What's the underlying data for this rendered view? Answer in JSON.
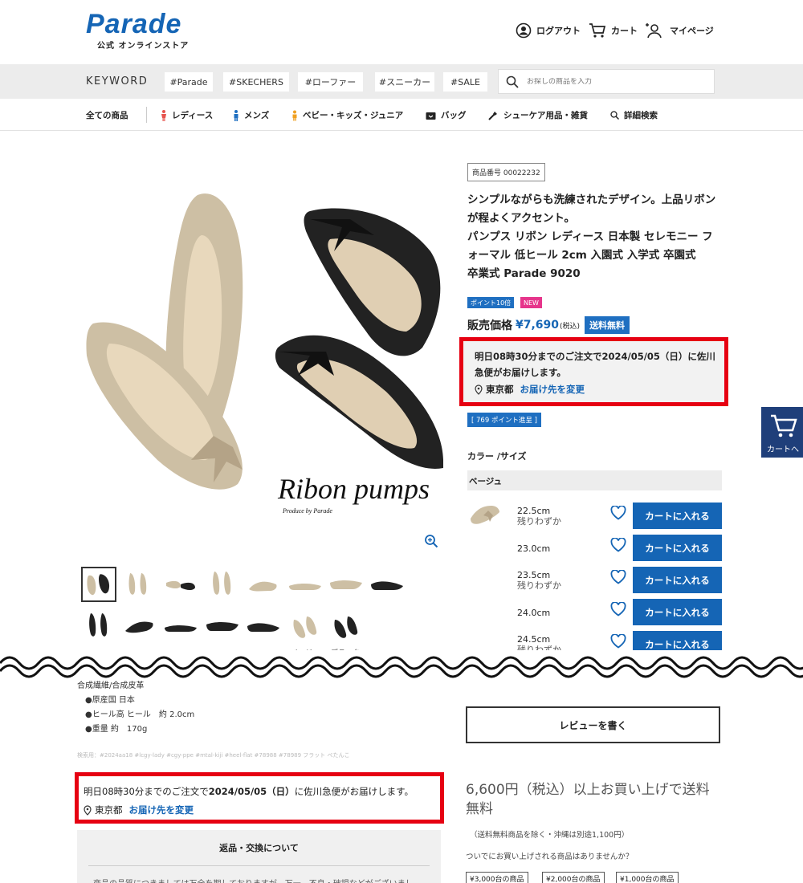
{
  "header": {
    "logo": "Parade",
    "logo_sub": "公式 オンラインストア",
    "logout": "ログアウト",
    "cart": "カート",
    "mypage": "マイページ"
  },
  "keyword": {
    "title": "KEYWORD",
    "tags": [
      "#Parade",
      "#SKECHERS",
      "#ローファー",
      "#スニーカー",
      "#SALE"
    ],
    "placeholder": "お探しの商品を入力"
  },
  "categories": {
    "all": "全ての商品",
    "ladies": "レディース",
    "mens": "メンズ",
    "kids": "ベビー・キッズ・ジュニア",
    "bag": "バッグ",
    "care": "シューケア用品・雑貨",
    "detail": "詳細検索"
  },
  "product": {
    "number": "商品番号 00022232",
    "title_lines": [
      "シンプルながらも洗練されたデザイン。上品リボン",
      "が程よくアクセント。",
      "パンプス リボン レディース 日本製 セレモニー フ",
      "ォーマル 低ヒール 2cm 入園式 入学式 卒園式",
      "卒業式 Parade 9020"
    ],
    "badge_points": "ポイント10倍",
    "badge_new": "NEW",
    "price_label": "販売価格",
    "price": "¥7,690",
    "tax": "(税込)",
    "free_shipping": "送料無料",
    "points_gift": "[ 769 ポイント進呈 ]",
    "image_caption": "Ribon pumps",
    "image_produce": "Produce by Parade",
    "thumb_caption_1": "ベージュ",
    "thumb_caption_2": "ブラック"
  },
  "delivery": {
    "text": "明日08時30分までのご注文で2024/05/05（日）に佐川急便がお届けします。",
    "location": "東京都",
    "change": "お届け先を変更"
  },
  "delivery2": {
    "prefix": "明日08時30分までのご注文で",
    "date": "2024/05/05（日）",
    "suffix": "に佐川急便がお届けします。",
    "location": "東京都",
    "change": "お届け先を変更"
  },
  "colorsize": {
    "label": "カラー /サイズ",
    "color": "ベージュ",
    "cart_button": "カートに入れる",
    "rows": [
      {
        "size": "22.5cm",
        "stock": "残りわずか"
      },
      {
        "size": "23.0cm",
        "stock": ""
      },
      {
        "size": "23.5cm",
        "stock": "残りわずか"
      },
      {
        "size": "24.0cm",
        "stock": ""
      },
      {
        "size": "24.5cm",
        "stock": "残りわずか"
      }
    ]
  },
  "float_cart": "カートへ",
  "specs": {
    "material": "合成繊維/合成皮革",
    "origin": "●原産国 日本",
    "heel": "●ヒール高 ヒール　約 2.0cm",
    "weight": "●重量 約　170g",
    "search_tags": "検索用：#2024aa18 #lcgy-lady #cgy-ppe #mtal-kiji #heel-flat #78988 #78989 フラット ぺたんこ"
  },
  "returns": {
    "title": "返品・交換について",
    "snippet": "商品の品質につきましては万全を期しておりますが、万一、不良・破損などがございまし"
  },
  "review_button": "レビューを書く",
  "shipping_note": "6,600円（税込）以上お買い上げで送料無料",
  "shipping_small": "（送料無料商品を除く・沖縄は別途1,100円）",
  "suggest": "ついでにお買い上げされる商品はありませんか？",
  "price_tags": [
    "¥3,000台の商品",
    "¥2,000台の商品",
    "¥1,000台の商品"
  ],
  "colors": {
    "brand_blue": "#1565b5",
    "highlight_red": "#e60012",
    "badge_blue": "#1f6fc1",
    "badge_pink": "#e6358b"
  }
}
